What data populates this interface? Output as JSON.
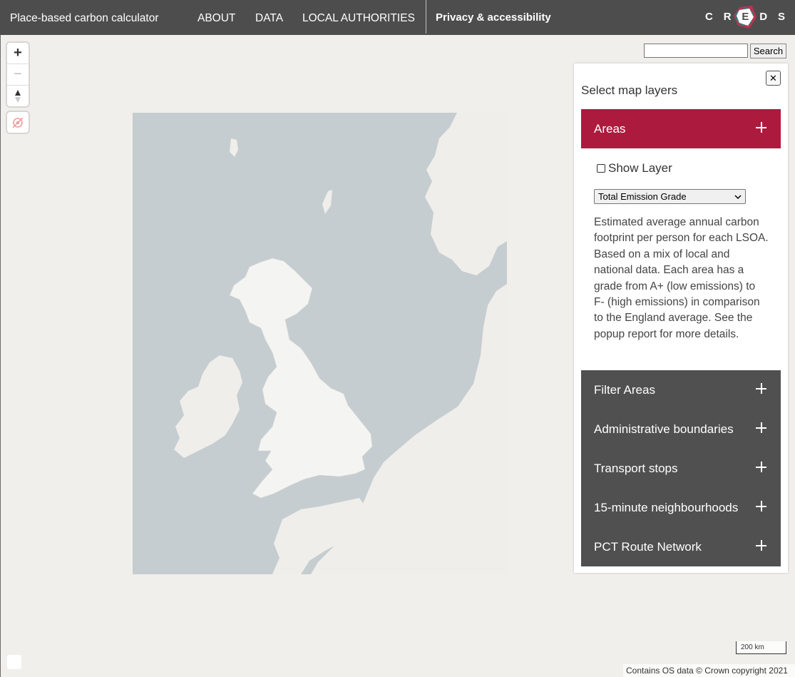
{
  "nav": {
    "title": "Place-based carbon calculator",
    "links": [
      "ABOUT",
      "DATA",
      "LOCAL AUTHORITIES"
    ],
    "privacy": "Privacy & accessibility",
    "logo_letters": [
      "C",
      "R",
      "E",
      "D",
      "S"
    ]
  },
  "map_controls": {
    "zoom_in": "+",
    "zoom_out": "−",
    "compass": "▲"
  },
  "search": {
    "value": "",
    "placeholder": "",
    "button": "Search"
  },
  "panel": {
    "close": "✕",
    "heading": "Select map layers",
    "sections": [
      {
        "label": "Areas",
        "active": true
      },
      {
        "label": "Filter Areas",
        "active": false
      },
      {
        "label": "Administrative boundaries",
        "active": false
      },
      {
        "label": "Transport stops",
        "active": false
      },
      {
        "label": "15-minute neighbourhoods",
        "active": false
      },
      {
        "label": "PCT Route Network",
        "active": false
      }
    ],
    "show_layer": "Show Layer",
    "show_layer_checked": false,
    "select_value": "Total Emission Grade",
    "description": "Estimated average annual carbon footprint per person for each LSOA. Based on a mix of local and national data. Each area has a grade from A+ (low emissions) to F- (high emissions) in comparison to the England average. See the popup report for more details."
  },
  "map": {
    "scale_label": "200 km",
    "attribution": "Contains OS data © Crown copyright 2021"
  },
  "colors": {
    "navbar": "#4d4d4d",
    "accent": "#ac1b3e",
    "accordion": "#505050",
    "sea": "#c6cdd0",
    "land": "#efeeea"
  }
}
